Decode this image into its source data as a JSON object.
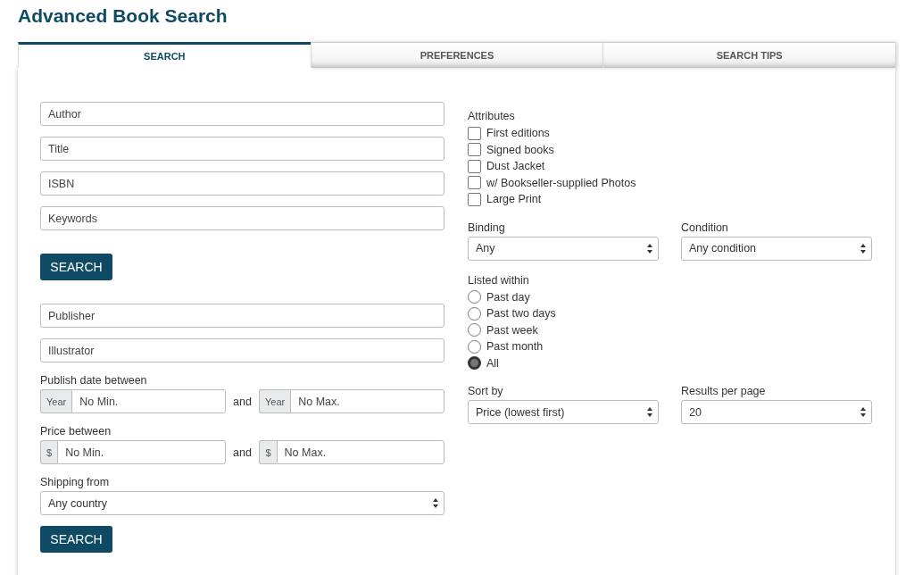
{
  "title": "Advanced Book Search",
  "tabs": [
    {
      "label": "SEARCH",
      "selected": true
    },
    {
      "label": "PREFERENCES",
      "selected": false
    },
    {
      "label": "SEARCH TIPS",
      "selected": false
    }
  ],
  "primary_fields": [
    {
      "placeholder": "Author"
    },
    {
      "placeholder": "Title"
    },
    {
      "placeholder": "ISBN"
    },
    {
      "placeholder": "Keywords"
    }
  ],
  "search_button": "SEARCH",
  "secondary_fields": [
    {
      "placeholder": "Publisher"
    },
    {
      "placeholder": "Illustrator"
    }
  ],
  "ranges": [
    {
      "label": "Publish date between",
      "joiner": "and",
      "min": {
        "addon": "Year",
        "placeholder": "No Min."
      },
      "max": {
        "addon": "Year",
        "placeholder": "No Max."
      }
    },
    {
      "label": "Price between",
      "joiner": "and",
      "min": {
        "addon": "$",
        "placeholder": "No Min."
      },
      "max": {
        "addon": "$",
        "placeholder": "No Max."
      }
    }
  ],
  "shipping": {
    "label": "Shipping from",
    "value": "Any country"
  },
  "bottom_button": "SEARCH",
  "attributes": {
    "label": "Attributes",
    "options": [
      {
        "label": "First editions",
        "checked": false
      },
      {
        "label": "Signed books",
        "checked": false
      },
      {
        "label": "Dust Jacket",
        "checked": false
      },
      {
        "label": "w/ Bookseller-supplied Photos",
        "checked": false
      },
      {
        "label": "Large Print",
        "checked": false
      }
    ]
  },
  "binding": {
    "label": "Binding",
    "value": "Any"
  },
  "condition": {
    "label": "Condition",
    "value": "Any condition"
  },
  "listed_within": {
    "label": "Listed within",
    "options": [
      {
        "label": "Past day",
        "selected": false
      },
      {
        "label": "Past two days",
        "selected": false
      },
      {
        "label": "Past week",
        "selected": false
      },
      {
        "label": "Past month",
        "selected": false
      },
      {
        "label": "All",
        "selected": true
      }
    ]
  },
  "sort_by": {
    "label": "Sort by",
    "value": "Price (lowest first)"
  },
  "results_per_page": {
    "label": "Results per page",
    "value": "20"
  }
}
